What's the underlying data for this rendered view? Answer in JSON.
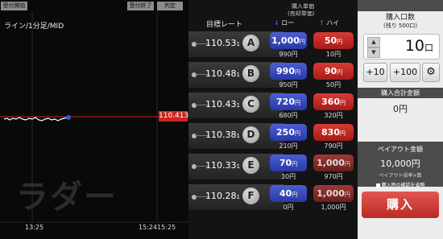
{
  "chart": {
    "btn_accept_start": "受付開始",
    "btn_accept_end": "受付終了",
    "btn_judge": "判定",
    "title": "ライン/1分足/MID",
    "price": "110.413",
    "watermark": "ラダー",
    "time_labels": [
      "13:25",
      "15:24",
      "15:25"
    ],
    "line_color": "#ffffff",
    "marker_color": "#2d5bd8",
    "price_line_color": "#c9281d"
  },
  "table": {
    "header_rate": "目標レート",
    "header_price": "購入単価",
    "header_sell": "(売却単価)",
    "header_low": "ロー",
    "header_high": "ハイ",
    "low_arrow_icon": "down-arrow-icon",
    "high_arrow_icon": "up-arrow-icon",
    "rows": [
      {
        "rate": "110.53",
        "sub": "1",
        "letter": "A",
        "low": "1,000",
        "low_unit": "円",
        "low_sell": "990円",
        "high": "50",
        "high_unit": "円",
        "high_sell": "10円",
        "high_dim": false
      },
      {
        "rate": "110.48",
        "sub": "1",
        "letter": "B",
        "low": "990",
        "low_unit": "円",
        "low_sell": "950円",
        "high": "90",
        "high_unit": "円",
        "high_sell": "50円",
        "high_dim": false
      },
      {
        "rate": "110.43",
        "sub": "1",
        "letter": "C",
        "low": "720",
        "low_unit": "円",
        "low_sell": "680円",
        "high": "360",
        "high_unit": "円",
        "high_sell": "320円",
        "high_dim": false
      },
      {
        "rate": "110.38",
        "sub": "1",
        "letter": "D",
        "low": "250",
        "low_unit": "円",
        "low_sell": "210円",
        "high": "830",
        "high_unit": "円",
        "high_sell": "790円",
        "high_dim": false
      },
      {
        "rate": "110.33",
        "sub": "1",
        "letter": "E",
        "low": "70",
        "low_unit": "円",
        "low_sell": "30円",
        "high": "1,000",
        "high_unit": "円",
        "high_sell": "970円",
        "high_dim": true
      },
      {
        "rate": "110.28",
        "sub": "1",
        "letter": "F",
        "low": "40",
        "low_unit": "円",
        "low_sell": "0円",
        "high": "1,000",
        "high_unit": "円",
        "high_sell": "1,000円",
        "high_dim": true
      }
    ]
  },
  "panel": {
    "qty_title": "購入口数",
    "qty_remaining": "(残り 500口)",
    "qty_value": "10",
    "qty_unit": "口",
    "plus10": "+10",
    "plus100": "+100",
    "settings_icon": "gear-icon",
    "total_title": "購入合計金額",
    "total_value": "0円",
    "payout_title": "ペイアウト金額",
    "payout_value": "10,000円",
    "payout_note": "ペイアウト倍率×数",
    "skip_confirm": "購入時の確認を省略",
    "buy_label": "購入"
  }
}
